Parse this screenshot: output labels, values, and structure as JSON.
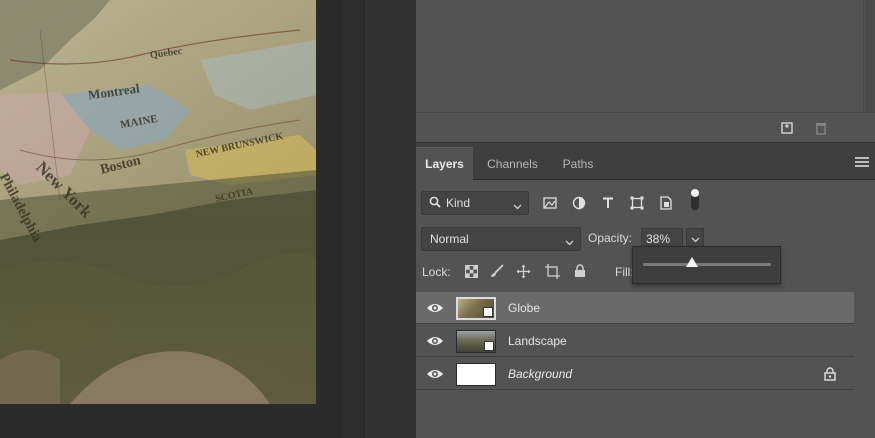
{
  "tabs": [
    {
      "label": "Layers",
      "active": true
    },
    {
      "label": "Channels",
      "active": false
    },
    {
      "label": "Paths",
      "active": false
    }
  ],
  "filter": {
    "kind_label": "Kind",
    "icons": [
      "pixel-filter-icon",
      "adjustment-filter-icon",
      "type-filter-icon",
      "shape-filter-icon",
      "smart-object-filter-icon",
      "filter-toggle-icon"
    ]
  },
  "blend": {
    "mode": "Normal",
    "opacity_label": "Opacity:",
    "opacity_value": "38%",
    "opacity_fraction": 0.38
  },
  "lock": {
    "label": "Lock:",
    "icons": [
      "lock-transparent-pixels-icon",
      "lock-image-pixels-icon",
      "lock-position-icon",
      "lock-artboard-icon",
      "lock-all-icon"
    ],
    "fill_label": "Fill:"
  },
  "layers": [
    {
      "name": "Globe",
      "selected": true,
      "italic": false,
      "locked": false
    },
    {
      "name": "Landscape",
      "selected": false,
      "italic": false,
      "locked": false
    },
    {
      "name": "Background",
      "selected": false,
      "italic": true,
      "locked": true
    }
  ],
  "map_words": [
    "Montreal",
    "MAINE",
    "Boston",
    "New York",
    "Philadelphia",
    "NEW BRUNSWICK",
    "SCOTIA",
    "Quebec"
  ],
  "colors": {
    "panel_bg": "#535353",
    "dock_bg": "#323232",
    "selected_row": "#6a6a6a",
    "tab_bar": "#3f3f3f",
    "canvas_bg": "#282828"
  }
}
